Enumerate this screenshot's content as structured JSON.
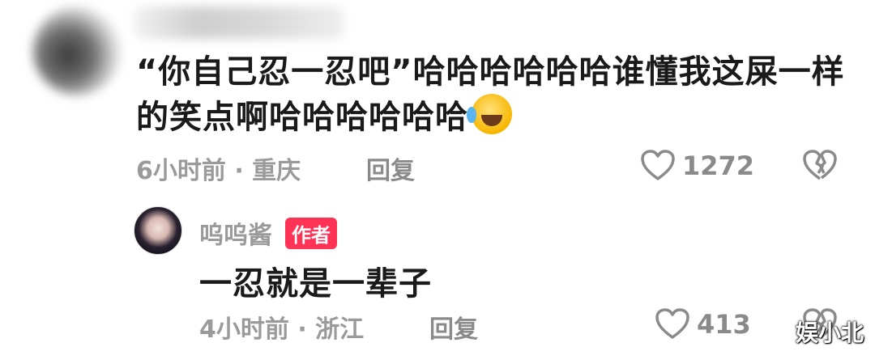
{
  "comment": {
    "text": "“你自己忍一忍吧”哈哈哈哈哈哈谁懂我这屎一样的笑点啊哈哈哈哈哈哈",
    "emoji": "rolling-on-floor-laughing",
    "time_location": "6小时前 · 重庆",
    "reply_label": "回复",
    "like_count": "1272"
  },
  "reply": {
    "author": "呜呜酱",
    "badge": "作者",
    "text": "一忍就是一辈子",
    "time_location": "4小时前 · 浙江",
    "reply_label": "回复",
    "like_count": "413"
  },
  "watermark": "娱小北",
  "colors": {
    "text": "#1a1a1a",
    "meta": "#9a9a9a",
    "badge": "#ff3355"
  }
}
